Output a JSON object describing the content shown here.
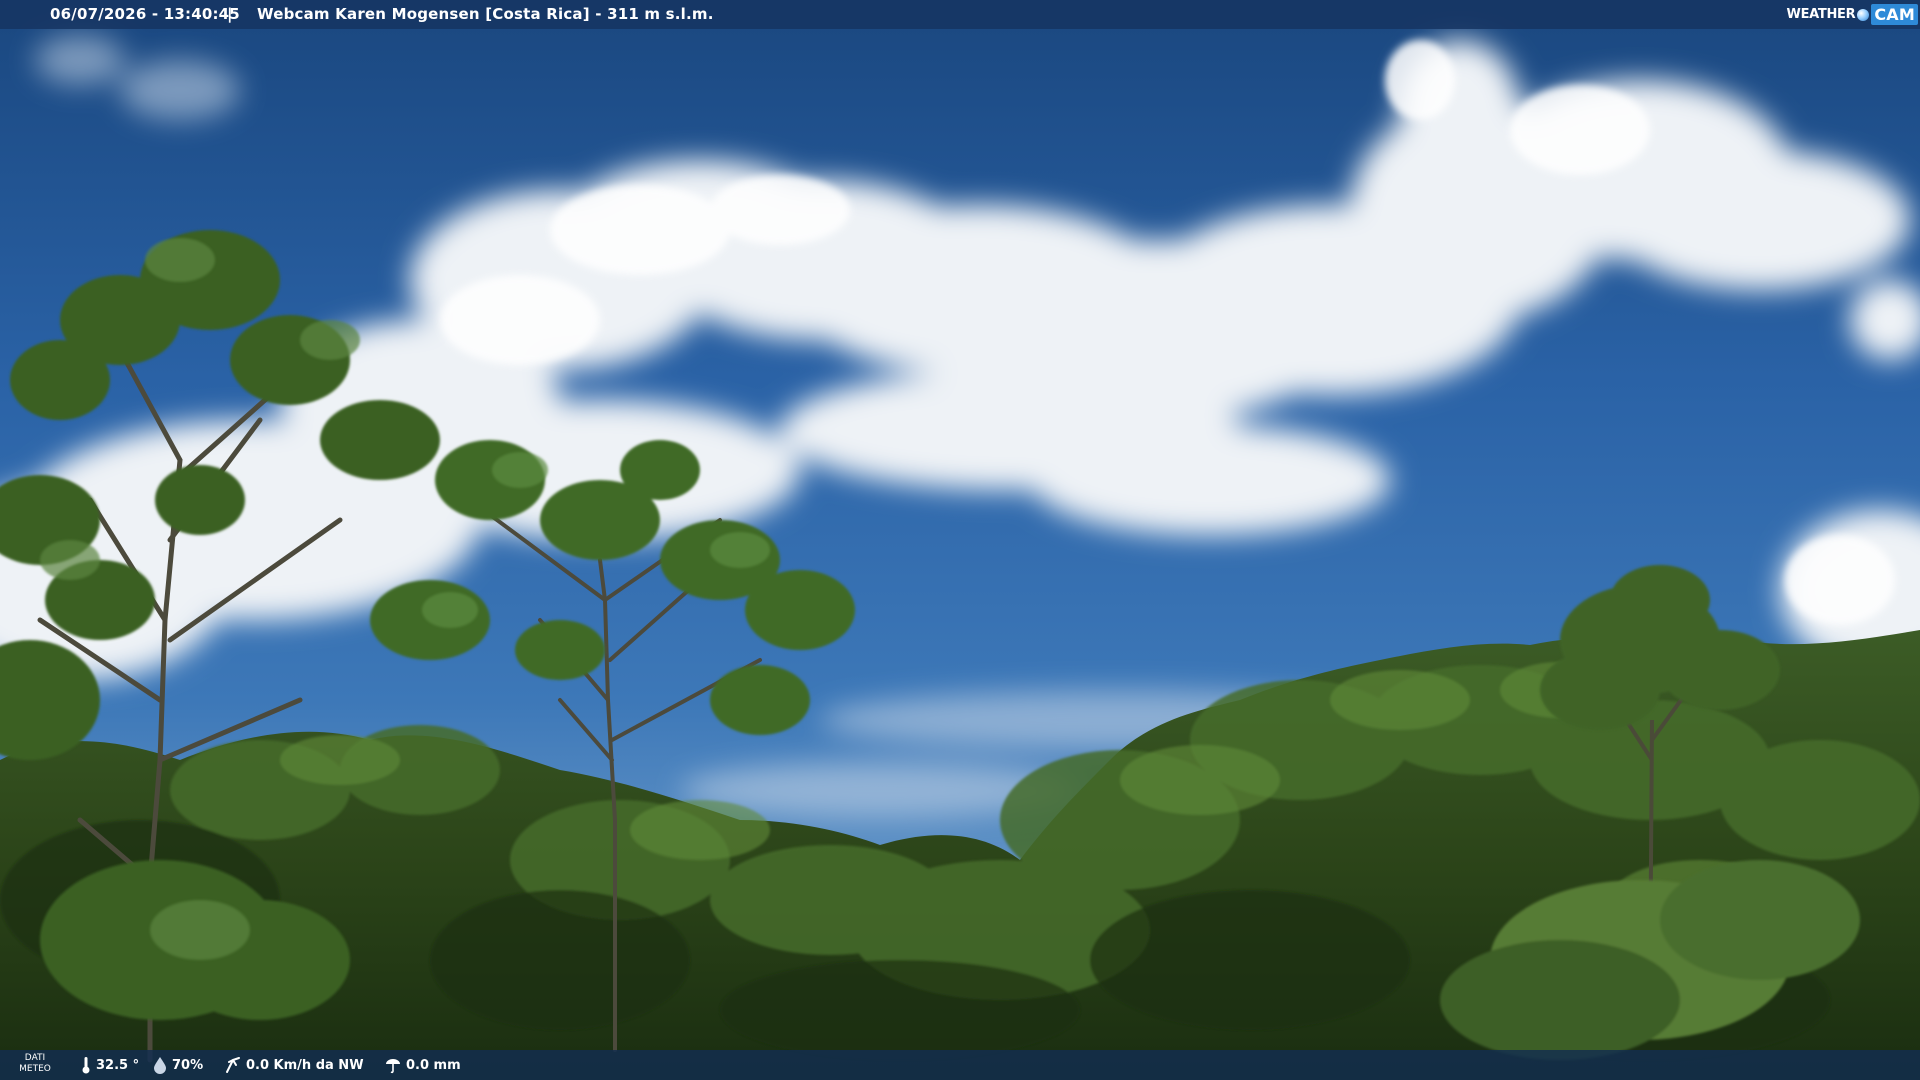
{
  "overlay": {
    "timestamp": "06/07/2026 - 13:40:45",
    "separator": "|",
    "camera_label": "Webcam Karen Mogensen [Costa Rica]  - 311 m s.l.m.",
    "logo": {
      "word": "WEATHER",
      "cam": "CAM"
    }
  },
  "meteo": {
    "label_line1": "DATI",
    "label_line2": "METEO",
    "temperature": "32.5 °",
    "humidity": "70%",
    "wind": "0.0 Km/h da NW",
    "rain": "0.0 mm"
  },
  "scene": {
    "description_icons": [
      "thermometer-icon",
      "humidity-drop-icon",
      "wind-icon",
      "rain-icon"
    ],
    "colors": {
      "sky_top": "#1d4f8f",
      "sky_mid": "#2f6db3",
      "sky_low": "#6e9fcf",
      "cloud": "#f2f5f8",
      "foliage_dark": "#1e3416",
      "foliage_mid": "#34521f",
      "foliage_light": "#5c7f38"
    }
  }
}
